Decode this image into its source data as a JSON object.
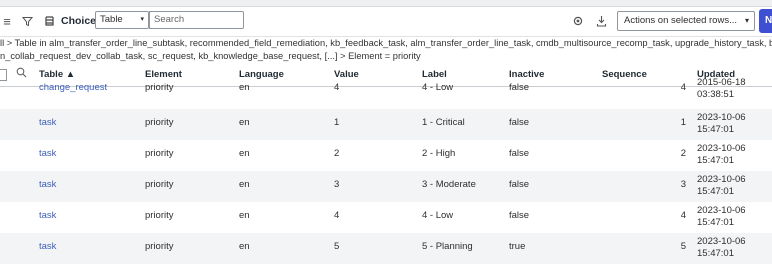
{
  "toolbar": {
    "title": "Choices",
    "table_select": "Table",
    "search_placeholder": "Search",
    "actions_select": "Actions on selected rows...",
    "new_label": "Ne"
  },
  "breadcrumb": {
    "line1": "ll > Table in alm_transfer_order_line_subtask, recommended_field_remediation, kb_feedback_task, alm_transfer_order_line_task, cmdb_multisource_recomp_task, upgrade_history_task, business_app_requ",
    "line2": "n_collab_request_dev_collab_task, sc_request, kb_knowledge_base_request, [...] > Element = priority"
  },
  "columns": {
    "table": "Table ▲",
    "element": "Element",
    "language": "Language",
    "value": "Value",
    "label": "Label",
    "inactive": "Inactive",
    "sequence": "Sequence",
    "updated": "Updated"
  },
  "rows": [
    {
      "table": "change_request",
      "element": "priority",
      "language": "en",
      "value": "4",
      "label": "4 - Low",
      "inactive": "false",
      "sequence": "4",
      "updated_date": "2015-06-18",
      "updated_time": "03:38:51"
    },
    {
      "table": "task",
      "element": "priority",
      "language": "en",
      "value": "1",
      "label": "1 - Critical",
      "inactive": "false",
      "sequence": "1",
      "updated_date": "2023-10-06",
      "updated_time": "15:47:01"
    },
    {
      "table": "task",
      "element": "priority",
      "language": "en",
      "value": "2",
      "label": "2 - High",
      "inactive": "false",
      "sequence": "2",
      "updated_date": "2023-10-06",
      "updated_time": "15:47:01"
    },
    {
      "table": "task",
      "element": "priority",
      "language": "en",
      "value": "3",
      "label": "3 - Moderate",
      "inactive": "false",
      "sequence": "3",
      "updated_date": "2023-10-06",
      "updated_time": "15:47:01"
    },
    {
      "table": "task",
      "element": "priority",
      "language": "en",
      "value": "4",
      "label": "4 - Low",
      "inactive": "false",
      "sequence": "4",
      "updated_date": "2023-10-06",
      "updated_time": "15:47:01"
    },
    {
      "table": "task",
      "element": "priority",
      "language": "en",
      "value": "5",
      "label": "5 - Planning",
      "inactive": "true",
      "sequence": "5",
      "updated_date": "2023-10-06",
      "updated_time": "15:47:01"
    }
  ],
  "colors": {
    "accent": "#3f4fd1",
    "link": "#3d5fba",
    "highlight_border": "#d0202c",
    "highlight_fill": "#c8cbf0"
  }
}
